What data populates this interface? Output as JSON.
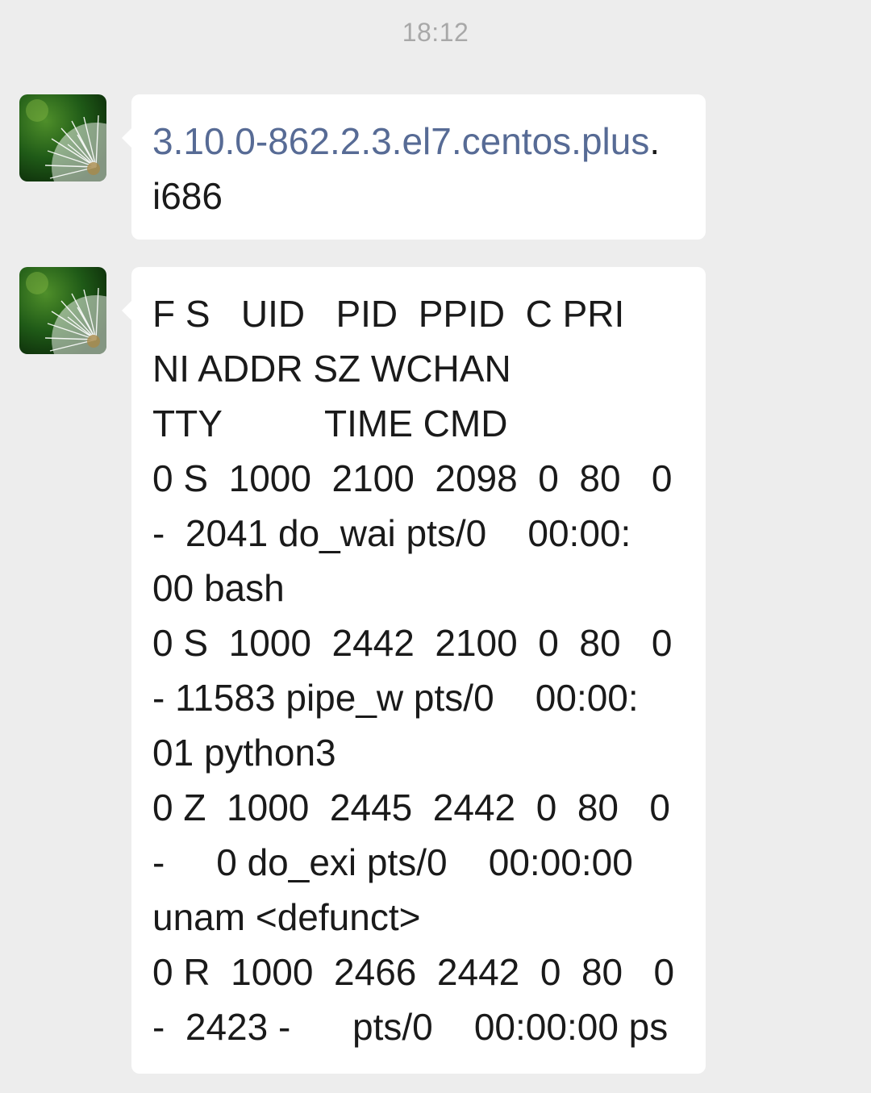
{
  "chat": {
    "timestamp": "18:12",
    "messages": [
      {
        "lines": [
          {
            "link": "3.10.0-862.2.3.el7.centos.plus",
            "text": "."
          },
          {
            "text": "i686"
          }
        ]
      },
      {
        "lines": [
          {
            "text": "F S   UID   PID  PPID  C PRI"
          },
          {
            "text": "NI ADDR SZ WCHAN"
          },
          {
            "text": "TTY          TIME CMD"
          },
          {
            "text": "0 S  1000  2100  2098  0  80   0"
          },
          {
            "text": "-  2041 do_wai pts/0    00:00:"
          },
          {
            "text": "00 bash"
          },
          {
            "text": "0 S  1000  2442  2100  0  80   0"
          },
          {
            "text": "- 11583 pipe_w pts/0    00:00:"
          },
          {
            "text": "01 python3"
          },
          {
            "text": "0 Z  1000  2445  2442  0  80   0"
          },
          {
            "text": "-     0 do_exi pts/0    00:00:00"
          },
          {
            "text": "unam <defunct>"
          },
          {
            "text": "0 R  1000  2466  2442  0  80   0"
          },
          {
            "text": "-  2423 -      pts/0    00:00:00 ps"
          }
        ]
      }
    ]
  },
  "colors": {
    "background": "#ededed",
    "bubble": "#ffffff",
    "link": "#576b95",
    "timestamp": "#a8a8a8"
  }
}
